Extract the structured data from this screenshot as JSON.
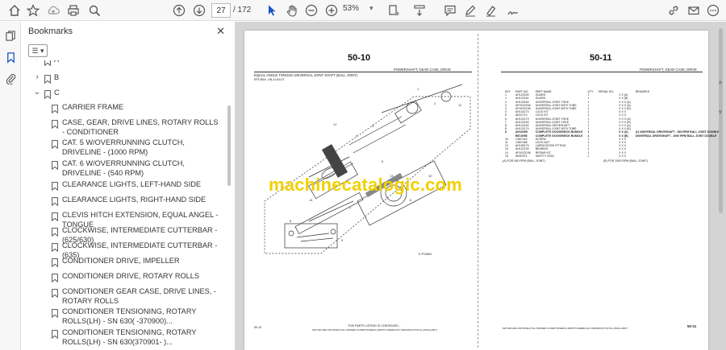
{
  "toolbar": {
    "current_page": "27",
    "page_total": "/ 172",
    "zoom": "53%"
  },
  "bookmarks_panel": {
    "title": "Bookmarks",
    "items": [
      {
        "label": "A",
        "level": 0,
        "toggle": "›"
      },
      {
        "label": "B",
        "level": 0,
        "toggle": "›"
      },
      {
        "label": "C",
        "level": 0,
        "toggle": "⌄"
      },
      {
        "label": "CARRIER FRAME",
        "level": 1
      },
      {
        "label": "CASE, GEAR, DRIVE LINES, ROTARY ROLLS - CONDITIONER",
        "level": 1
      },
      {
        "label": "CAT. 5 W/OVERRUNNING CLUTCH, DRIVELINE - (1000 RPM)",
        "level": 1
      },
      {
        "label": "CAT. 6 W/OVERRUNNING CLUTCH, DRIVELINE - (540 RPM)",
        "level": 1
      },
      {
        "label": "CLEARANCE LIGHTS, LEFT-HAND SIDE",
        "level": 1
      },
      {
        "label": "CLEARANCE LIGHTS, RIGHT-HAND SIDE",
        "level": 1
      },
      {
        "label": "CLEVIS HITCH EXTENSION, EQUAL ANGEL - TONGUE",
        "level": 1
      },
      {
        "label": "CLOCKWISE, INTERMEDIATE CUTTERBAR - (625/630)",
        "level": 1
      },
      {
        "label": "CLOCKWISE, INTERMEDIATE CUTTERBAR - (635)",
        "level": 1
      },
      {
        "label": "CONDITIONER DRIVE, IMPELLER",
        "level": 1
      },
      {
        "label": "CONDITIONER DRIVE, ROTARY ROLLS",
        "level": 1
      },
      {
        "label": "CONDITIONER GEAR CASE, DRIVE LINES, - ROTARY ROLLS",
        "level": 1
      },
      {
        "label": "CONDITIONER TENSIONING, ROTARY ROLLS(LH) - SN 630( -370900)...",
        "level": 1
      },
      {
        "label": "CONDITIONER TENSIONING, ROTARY ROLLS(LH) - SN 630(370901- )...",
        "level": 1
      }
    ]
  },
  "document": {
    "left_page": {
      "number": "50-10",
      "header_right": "POWERSHAFT, GEAR CASE, DRIVE",
      "figure_title": "EQUAL ANGLE TONGUE UNIVERSAL JOINT SHAFT (BALL JOINT)",
      "figure_code": "EP13834        -UN-11JUL07",
      "figure_ref": "E-P13834",
      "footer_left": "50-10",
      "footer_center": "THIS PARTS LISTING IS CONTINUED...",
      "footer_sub": "625 630 AND 635 SIDE-PULL MOWER CONDITIONERS (NORTH AMERICAN VERSION)   PC9711   (25JUL2007)"
    },
    "right_page": {
      "number": "50-11",
      "header_right": "POWERSHAFT, GEAR CASE, DRIVE",
      "columns": [
        "KEY",
        "PART NO.",
        "PART NAME",
        "QTY",
        "SERIAL NO.",
        "",
        "REMARKS"
      ],
      "rows": [
        [
          "1",
          "AH122150",
          "GUARD",
          "1",
          "",
          "X X (A)",
          ""
        ],
        [
          "1",
          "AH122151",
          "GUARD",
          "1",
          "",
          "X X (B)",
          ""
        ],
        [
          "2",
          "AH122169",
          "UNIVERSAL JOINT YOKE",
          "1",
          "",
          "X X X (A)",
          ""
        ],
        [
          "3",
          "AFH222206",
          "UNIVERSAL JOINT WITH TUBE",
          "1",
          "",
          "X X X (A)",
          ""
        ],
        [
          "3",
          "AFH222196",
          "UNIVERSAL JOINT WITH TUBE",
          "1",
          "",
          "X X X (B)",
          ""
        ],
        [
          "4",
          "AH104170",
          "LOCK KIT",
          "1",
          "",
          "X X X",
          ""
        ],
        [
          "5",
          "AE42719",
          "LOCK KIT",
          "1",
          "",
          "X X X",
          ""
        ],
        [
          "6",
          "AH122179",
          "UNIVERSAL JOINT YOKE",
          "1",
          "",
          "X X X (A)",
          ""
        ],
        [
          "7",
          "AH122163",
          "UNIVERSAL JOINT YOKE",
          "1",
          "",
          "X X X (B)",
          ""
        ],
        [
          "8",
          "AH122162",
          "UNIVERSAL DRIVESHAFT",
          "1",
          "",
          "X X X (A)",
          ""
        ],
        [
          "8",
          "AH122174",
          "UNIVERSAL JOINT WITH TUBE",
          "1",
          "",
          "X X X (B)",
          ""
        ],
        [
          "8",
          "AH10395",
          "COMPLETE GOOSENECK BUNDLE",
          "1",
          "",
          "X X (A)",
          "(1) UNIVERSAL DRIVESHAFT - 540 RPM BALL JOINT DOUBLE"
        ],
        [
          "",
          "BE10056",
          "COMPLETE GOOSENECK BUNDLE",
          "1",
          "",
          "X X (B)",
          "UNIVERSAL DRIVESHAFT - 1000 RPM BALL JOINT DOUBLE"
        ],
        [
          "10",
          "14M7415",
          "SCREW",
          "1",
          "",
          "X X X",
          ""
        ],
        [
          "11",
          "14M7468",
          "LOCK NUT",
          "1",
          "",
          "X X X",
          ""
        ],
        [
          "12",
          "AH155175",
          "LUBRICATION FITTING",
          "1",
          "",
          "X X X",
          ""
        ],
        [
          "13",
          "AH122139",
          "BEARING",
          "1",
          "",
          "X X X",
          ""
        ],
        [
          "14",
          "AFH222196",
          "REPAIR KIT",
          "1",
          "",
          "X X X",
          ""
        ],
        [
          "15",
          "AE60374",
          "SAFETY SIGN",
          "1",
          "",
          "X X X",
          ""
        ]
      ],
      "note_a": "(A) FOR 540 RPM (BALL JOINT)",
      "note_b": "(B) FOR 1000 RPM (BALL JOINT)",
      "footer_left": "625 630 AND 635 SIDE-PULL MOWER CONDITIONERS (NORTH AMERICAN VERSION)   PC9711   (25JUL2007)",
      "footer_right": "50-11"
    },
    "watermark": "machinecatalogic.com"
  }
}
